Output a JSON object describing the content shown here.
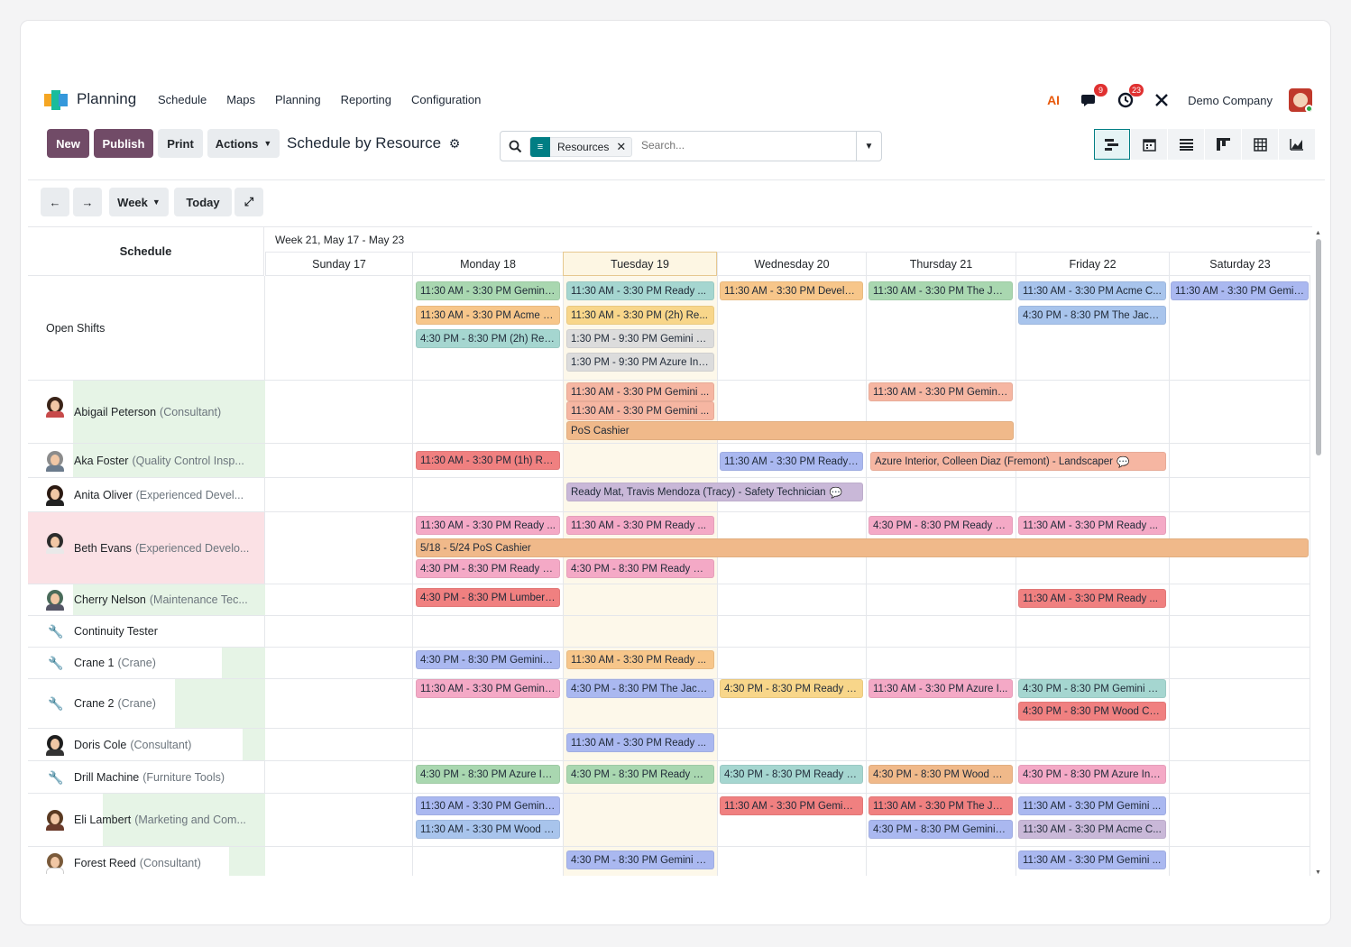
{
  "app": {
    "name": "Planning",
    "menu": [
      "Schedule",
      "Maps",
      "Planning",
      "Reporting",
      "Configuration"
    ]
  },
  "nav_right": {
    "ai_icon": "AI",
    "chat_badge": "9",
    "activity_badge": "23",
    "company": "Demo Company"
  },
  "controls": {
    "new": "New",
    "publish": "Publish",
    "print": "Print",
    "actions": "Actions",
    "title": "Schedule by Resource"
  },
  "search": {
    "facet": "Resources",
    "placeholder": "Search..."
  },
  "toolbar": {
    "week": "Week",
    "today": "Today"
  },
  "gantt": {
    "schedule_header": "Schedule",
    "week_label": "Week 21, May 17 - May 23",
    "days": [
      "Sunday 17",
      "Monday 18",
      "Tuesday 19",
      "Wednesday 20",
      "Thursday 21",
      "Friday 22",
      "Saturday 23"
    ],
    "rows": [
      {
        "name": "Open Shifts",
        "role": ""
      },
      {
        "name": "Abigail Peterson",
        "role": "(Consultant)"
      },
      {
        "name": "Aka Foster",
        "role": "(Quality Control Insp..."
      },
      {
        "name": "Anita Oliver",
        "role": "(Experienced Devel..."
      },
      {
        "name": "Beth Evans",
        "role": "(Experienced Develo..."
      },
      {
        "name": "Cherry Nelson",
        "role": "(Maintenance Tec..."
      },
      {
        "name": "Continuity Tester",
        "role": ""
      },
      {
        "name": "Crane 1",
        "role": "(Crane)"
      },
      {
        "name": "Crane 2",
        "role": "(Crane)"
      },
      {
        "name": "Doris Cole",
        "role": "(Consultant)"
      },
      {
        "name": "Drill Machine",
        "role": "(Furniture Tools)"
      },
      {
        "name": "Eli Lambert",
        "role": "(Marketing and Com..."
      },
      {
        "name": "Forest Reed",
        "role": "(Consultant)"
      }
    ],
    "shifts": [
      "11:30 AM - 3:30 PM Gemini ...",
      "11:30 AM - 3:30 PM Ready ...",
      "11:30 AM - 3:30 PM Develo...",
      "11:30 AM - 3:30 PM The Jac...",
      "11:30 AM - 3:30 PM Acme C...",
      "11:30 AM - 3:30 PM Gemini...",
      "11:30 AM - 3:30 PM Acme C...",
      "11:30 AM - 3:30 PM (2h) Re...",
      "4:30 PM - 8:30 PM The Jack...",
      "4:30 PM - 8:30 PM (2h) Read...",
      "1:30 PM - 9:30 PM Gemini F...",
      "1:30 PM - 9:30 PM Azure Int...",
      "11:30 AM - 3:30 PM Gemini ...",
      "11:30 AM - 3:30 PM Gemini ...",
      "11:30 AM - 3:30 PM Gemini ...",
      "PoS Cashier",
      "11:30 AM - 3:30 PM (1h) Re...",
      "11:30 AM - 3:30 PM Ready ...",
      "Azure Interior, Colleen Diaz (Fremont) - Landscaper",
      "Ready Mat, Travis Mendoza (Tracy) - Safety Technician",
      "11:30 AM - 3:30 PM Ready ...",
      "11:30 AM - 3:30 PM Ready ...",
      "4:30 PM - 8:30 PM Ready M...",
      "11:30 AM - 3:30 PM Ready ...",
      "5/18 - 5/24 PoS Cashier",
      "4:30 PM - 8:30 PM Ready M...",
      "4:30 PM - 8:30 PM Ready M...",
      "4:30 PM - 8:30 PM Lumber I...",
      "11:30 AM - 3:30 PM Ready ...",
      "4:30 PM - 8:30 PM Gemini F...",
      "11:30 AM - 3:30 PM Ready ...",
      "11:30 AM - 3:30 PM Gemini ...",
      "4:30 PM - 8:30 PM The Jack...",
      "4:30 PM - 8:30 PM Ready M...",
      "11:30 AM - 3:30 PM Azure I...",
      "4:30 PM - 8:30 PM Gemini F...",
      "4:30 PM - 8:30 PM Wood Co...",
      "11:30 AM - 3:30 PM Ready ...",
      "4:30 PM - 8:30 PM Azure Int...",
      "4:30 PM - 8:30 PM Ready M...",
      "4:30 PM - 8:30 PM Ready M...",
      "4:30 PM - 8:30 PM Wood Co...",
      "4:30 PM - 8:30 PM Azure Int...",
      "11:30 AM - 3:30 PM Gemini ...",
      "11:30 AM - 3:30 PM Gemini ...",
      "11:30 AM - 3:30 PM The Jac...",
      "11:30 AM - 3:30 PM Gemini ...",
      "11:30 AM - 3:30 PM Wood C...",
      "4:30 PM - 8:30 PM Gemini F...",
      "11:30 AM - 3:30 PM Acme C...",
      "4:30 PM - 8:30 PM Gemini F...",
      "11:30 AM - 3:30 PM Gemini ..."
    ]
  },
  "colors": {
    "brand": "#714b67",
    "accent": "#017e84",
    "today": "#fdf8ea"
  }
}
